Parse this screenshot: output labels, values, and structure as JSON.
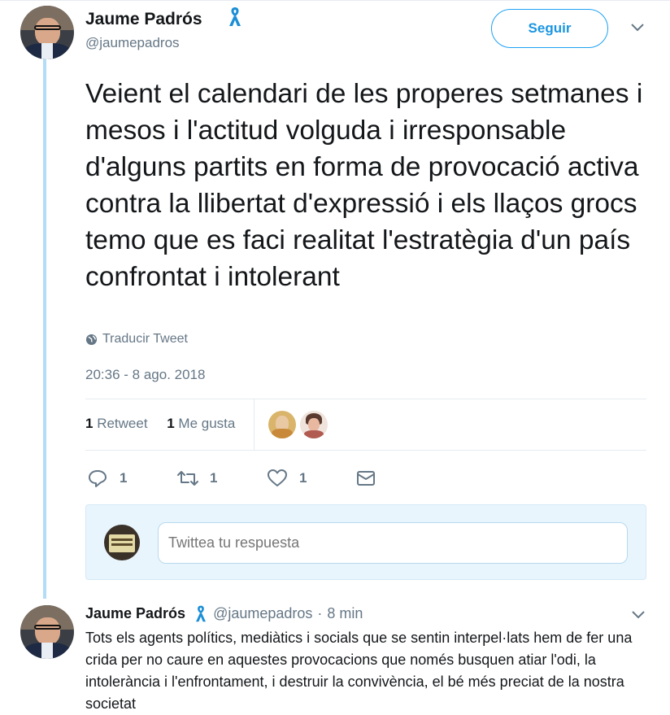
{
  "main_tweet": {
    "author_name": "Jaume Padrós",
    "author_handle": "@jaumepadros",
    "follow_label": "Seguir",
    "text": "Veient el calendari de les properes setmanes i mesos i l'actitud volguda i irresponsable d'alguns partits en forma de provocació activa contra la llibertat d'expressió i els llaços grocs temo que es faci realitat l'estratègia d'un país confrontat i intolerant",
    "translate_label": "Traducir Tweet",
    "timestamp": "20:36 - 8 ago. 2018",
    "stats": {
      "retweet_count": "1",
      "retweet_label": "Retweet",
      "like_count": "1",
      "like_label": "Me gusta"
    },
    "actions": {
      "reply_count": "1",
      "retweet_count": "1",
      "like_count": "1"
    }
  },
  "reply_composer": {
    "placeholder": "Twittea tu respuesta"
  },
  "reply_tweet": {
    "author_name": "Jaume Padrós",
    "author_handle": "@jaumepadros",
    "separator": "·",
    "time": "8 min",
    "text": "Tots els agents polítics, mediàtics i socials que se sentin interpel·lats hem de fer una crida per no caure en aquestes provocacions que només busquen atiar l'odi, la intolerància i l'enfrontament, i destruir la convivència, el bé més preciat de la nostra societat"
  },
  "colors": {
    "accent": "#1da1f2",
    "ribbon": "#1b8ed6",
    "thread_line": "#b3dcf7",
    "secondary_text": "#657786"
  }
}
